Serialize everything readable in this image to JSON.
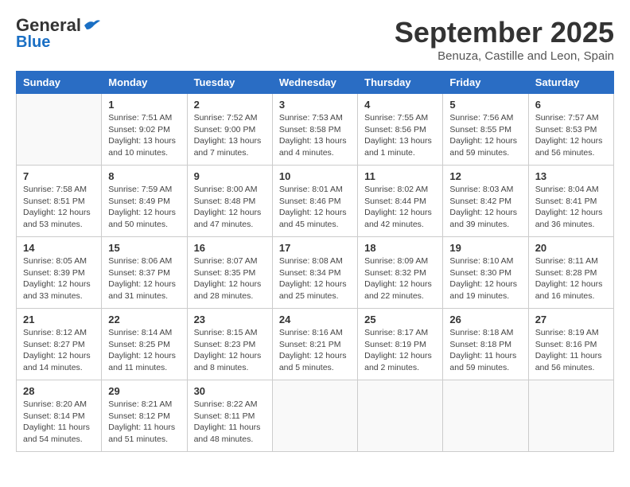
{
  "header": {
    "logo_line1": "General",
    "logo_line2": "Blue",
    "title": "September 2025",
    "subtitle": "Benuza, Castille and Leon, Spain"
  },
  "weekdays": [
    "Sunday",
    "Monday",
    "Tuesday",
    "Wednesday",
    "Thursday",
    "Friday",
    "Saturday"
  ],
  "weeks": [
    [
      {
        "day": "",
        "info": ""
      },
      {
        "day": "1",
        "info": "Sunrise: 7:51 AM\nSunset: 9:02 PM\nDaylight: 13 hours\nand 10 minutes."
      },
      {
        "day": "2",
        "info": "Sunrise: 7:52 AM\nSunset: 9:00 PM\nDaylight: 13 hours\nand 7 minutes."
      },
      {
        "day": "3",
        "info": "Sunrise: 7:53 AM\nSunset: 8:58 PM\nDaylight: 13 hours\nand 4 minutes."
      },
      {
        "day": "4",
        "info": "Sunrise: 7:55 AM\nSunset: 8:56 PM\nDaylight: 13 hours\nand 1 minute."
      },
      {
        "day": "5",
        "info": "Sunrise: 7:56 AM\nSunset: 8:55 PM\nDaylight: 12 hours\nand 59 minutes."
      },
      {
        "day": "6",
        "info": "Sunrise: 7:57 AM\nSunset: 8:53 PM\nDaylight: 12 hours\nand 56 minutes."
      }
    ],
    [
      {
        "day": "7",
        "info": "Sunrise: 7:58 AM\nSunset: 8:51 PM\nDaylight: 12 hours\nand 53 minutes."
      },
      {
        "day": "8",
        "info": "Sunrise: 7:59 AM\nSunset: 8:49 PM\nDaylight: 12 hours\nand 50 minutes."
      },
      {
        "day": "9",
        "info": "Sunrise: 8:00 AM\nSunset: 8:48 PM\nDaylight: 12 hours\nand 47 minutes."
      },
      {
        "day": "10",
        "info": "Sunrise: 8:01 AM\nSunset: 8:46 PM\nDaylight: 12 hours\nand 45 minutes."
      },
      {
        "day": "11",
        "info": "Sunrise: 8:02 AM\nSunset: 8:44 PM\nDaylight: 12 hours\nand 42 minutes."
      },
      {
        "day": "12",
        "info": "Sunrise: 8:03 AM\nSunset: 8:42 PM\nDaylight: 12 hours\nand 39 minutes."
      },
      {
        "day": "13",
        "info": "Sunrise: 8:04 AM\nSunset: 8:41 PM\nDaylight: 12 hours\nand 36 minutes."
      }
    ],
    [
      {
        "day": "14",
        "info": "Sunrise: 8:05 AM\nSunset: 8:39 PM\nDaylight: 12 hours\nand 33 minutes."
      },
      {
        "day": "15",
        "info": "Sunrise: 8:06 AM\nSunset: 8:37 PM\nDaylight: 12 hours\nand 31 minutes."
      },
      {
        "day": "16",
        "info": "Sunrise: 8:07 AM\nSunset: 8:35 PM\nDaylight: 12 hours\nand 28 minutes."
      },
      {
        "day": "17",
        "info": "Sunrise: 8:08 AM\nSunset: 8:34 PM\nDaylight: 12 hours\nand 25 minutes."
      },
      {
        "day": "18",
        "info": "Sunrise: 8:09 AM\nSunset: 8:32 PM\nDaylight: 12 hours\nand 22 minutes."
      },
      {
        "day": "19",
        "info": "Sunrise: 8:10 AM\nSunset: 8:30 PM\nDaylight: 12 hours\nand 19 minutes."
      },
      {
        "day": "20",
        "info": "Sunrise: 8:11 AM\nSunset: 8:28 PM\nDaylight: 12 hours\nand 16 minutes."
      }
    ],
    [
      {
        "day": "21",
        "info": "Sunrise: 8:12 AM\nSunset: 8:27 PM\nDaylight: 12 hours\nand 14 minutes."
      },
      {
        "day": "22",
        "info": "Sunrise: 8:14 AM\nSunset: 8:25 PM\nDaylight: 12 hours\nand 11 minutes."
      },
      {
        "day": "23",
        "info": "Sunrise: 8:15 AM\nSunset: 8:23 PM\nDaylight: 12 hours\nand 8 minutes."
      },
      {
        "day": "24",
        "info": "Sunrise: 8:16 AM\nSunset: 8:21 PM\nDaylight: 12 hours\nand 5 minutes."
      },
      {
        "day": "25",
        "info": "Sunrise: 8:17 AM\nSunset: 8:19 PM\nDaylight: 12 hours\nand 2 minutes."
      },
      {
        "day": "26",
        "info": "Sunrise: 8:18 AM\nSunset: 8:18 PM\nDaylight: 11 hours\nand 59 minutes."
      },
      {
        "day": "27",
        "info": "Sunrise: 8:19 AM\nSunset: 8:16 PM\nDaylight: 11 hours\nand 56 minutes."
      }
    ],
    [
      {
        "day": "28",
        "info": "Sunrise: 8:20 AM\nSunset: 8:14 PM\nDaylight: 11 hours\nand 54 minutes."
      },
      {
        "day": "29",
        "info": "Sunrise: 8:21 AM\nSunset: 8:12 PM\nDaylight: 11 hours\nand 51 minutes."
      },
      {
        "day": "30",
        "info": "Sunrise: 8:22 AM\nSunset: 8:11 PM\nDaylight: 11 hours\nand 48 minutes."
      },
      {
        "day": "",
        "info": ""
      },
      {
        "day": "",
        "info": ""
      },
      {
        "day": "",
        "info": ""
      },
      {
        "day": "",
        "info": ""
      }
    ]
  ]
}
